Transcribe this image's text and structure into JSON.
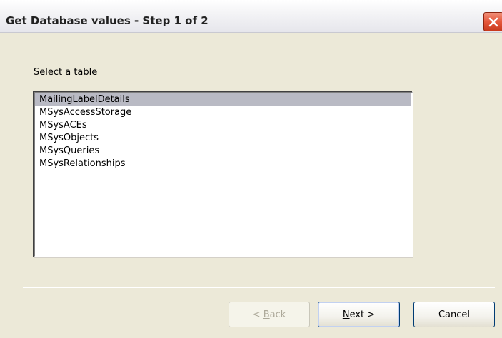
{
  "window": {
    "title": "Get Database values - Step 1 of 2",
    "close_icon": "close-icon"
  },
  "main": {
    "prompt": "Select a table",
    "tables": [
      {
        "label": "MailingLabelDetails",
        "selected": true
      },
      {
        "label": "MSysAccessStorage",
        "selected": false
      },
      {
        "label": "MSysACEs",
        "selected": false
      },
      {
        "label": "MSysObjects",
        "selected": false
      },
      {
        "label": "MSysQueries",
        "selected": false
      },
      {
        "label": "MSysRelationships",
        "selected": false
      }
    ]
  },
  "buttons": {
    "back_prefix": "< ",
    "back_accel": "B",
    "back_rest": "ack",
    "next_accel": "N",
    "next_rest": "ext >",
    "cancel": "Cancel"
  },
  "colors": {
    "close_button": "#e5573b",
    "selection": "#b9bac4",
    "dialog_background": "#ece9d8"
  }
}
